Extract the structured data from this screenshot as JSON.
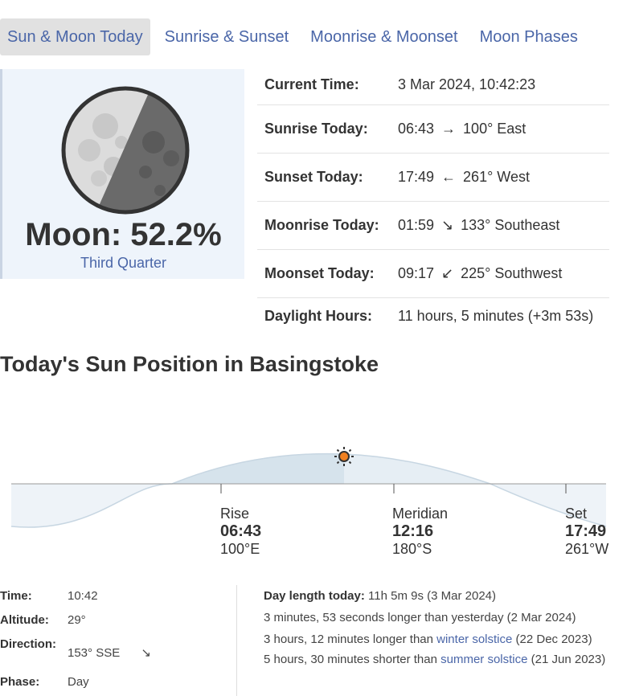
{
  "tabs": [
    "Sun & Moon Today",
    "Sunrise & Sunset",
    "Moonrise & Moonset",
    "Moon Phases"
  ],
  "moon": {
    "percent_label": "Moon: 52.2%",
    "phase": "Third Quarter"
  },
  "info": {
    "current_time": {
      "label": "Current Time:",
      "value": "3 Mar 2024, 10:42:23"
    },
    "sunrise": {
      "label": "Sunrise Today:",
      "time": "06:43",
      "arrow": "→",
      "dir": "100° East"
    },
    "sunset": {
      "label": "Sunset Today:",
      "time": "17:49",
      "arrow": "←",
      "dir": "261° West"
    },
    "moonrise": {
      "label": "Moonrise Today:",
      "time": "01:59",
      "arrow": "↘",
      "dir": "133° Southeast"
    },
    "moonset": {
      "label": "Moonset Today:",
      "time": "09:17",
      "arrow": "↙",
      "dir": "225° Southwest"
    },
    "daylight": {
      "label": "Daylight Hours:",
      "value": "11 hours, 5 minutes (+3m 53s)"
    }
  },
  "section_title": "Today's Sun Position in Basingstoke",
  "sun_chart": {
    "rise": {
      "name": "Rise",
      "time": "06:43",
      "dir": "100°E"
    },
    "meridian": {
      "name": "Meridian",
      "time": "12:16",
      "dir": "180°S"
    },
    "set": {
      "name": "Set",
      "time": "17:49",
      "dir": "261°W"
    }
  },
  "position": {
    "time": {
      "label": "Time:",
      "value": "10:42"
    },
    "altitude": {
      "label": "Altitude:",
      "value": "29°"
    },
    "direction": {
      "label": "Direction:",
      "value": "153° SSE",
      "arrow": "↘"
    },
    "phase": {
      "label": "Phase:",
      "value": "Day"
    }
  },
  "day_length": {
    "label": "Day length today:",
    "value": "11h 5m 9s (3 Mar 2024)",
    "line1": "3 minutes, 53 seconds longer than yesterday (2 Mar 2024)",
    "line2_pre": "3 hours, 12 minutes longer than ",
    "line2_link": "winter solstice",
    "line2_post": " (22 Dec 2023)",
    "line3_pre": "5 hours, 30 minutes shorter than ",
    "line3_link": "summer solstice",
    "line3_post": " (21 Jun 2023)"
  }
}
